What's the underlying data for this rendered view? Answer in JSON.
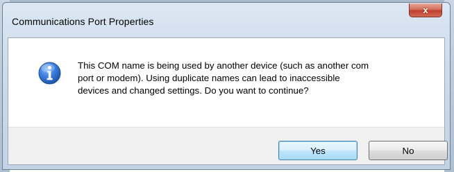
{
  "window": {
    "title": "Communications Port Properties",
    "close_glyph": "x"
  },
  "message": {
    "icon": "info-icon",
    "lines": [
      "This COM name is being used by another device (such as another com",
      "port or modem).  Using duplicate names can lead to inaccessible",
      "devices and changed settings.  Do you want to continue?"
    ]
  },
  "buttons": {
    "yes_label": "Yes",
    "no_label": "No",
    "default": "yes"
  },
  "colors": {
    "info_icon": "#2b67c4",
    "default_button_border": "#3c7fb1",
    "close_button": "#c0402c"
  }
}
